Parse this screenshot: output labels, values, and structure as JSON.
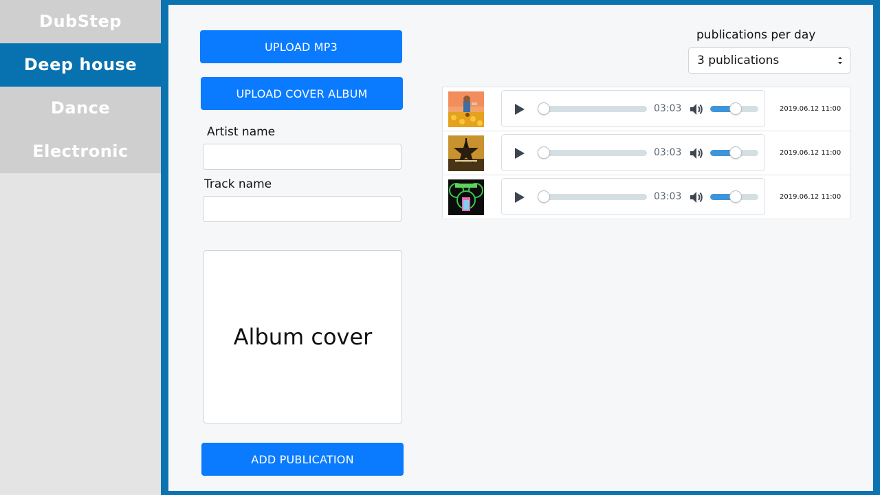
{
  "sidebar": {
    "items": [
      {
        "label": "DubStep",
        "active": false
      },
      {
        "label": "Deep house",
        "active": true
      },
      {
        "label": "Dance",
        "active": false
      },
      {
        "label": "Electronic",
        "active": false
      }
    ]
  },
  "form": {
    "upload_mp3_label": "UPLOAD MP3",
    "upload_cover_label": "UPLOAD COVER ALBUM",
    "artist_label": "Artist name",
    "artist_value": "",
    "track_label": "Track name",
    "track_value": "",
    "cover_placeholder": "Album cover",
    "add_publication_label": "ADD PUBLICATION"
  },
  "publications": {
    "per_day_label": "publications per day",
    "selected": "3 publications"
  },
  "tracks": [
    {
      "cover": "album-cover-sunflower",
      "time": "03:03",
      "date": "2019.06.12 11:00",
      "progress": 0,
      "volume": 0.53
    },
    {
      "cover": "album-cover-hamilton",
      "time": "03:03",
      "date": "2019.06.12 11:00",
      "progress": 0,
      "volume": 0.53
    },
    {
      "cover": "album-cover-deadmau5",
      "time": "03:03",
      "date": "2019.06.12 11:00",
      "progress": 0,
      "volume": 0.53
    }
  ],
  "colors": {
    "accent_blue": "#0871b0",
    "button_blue": "#0a7bff",
    "volume_fill": "#3e95d9"
  }
}
